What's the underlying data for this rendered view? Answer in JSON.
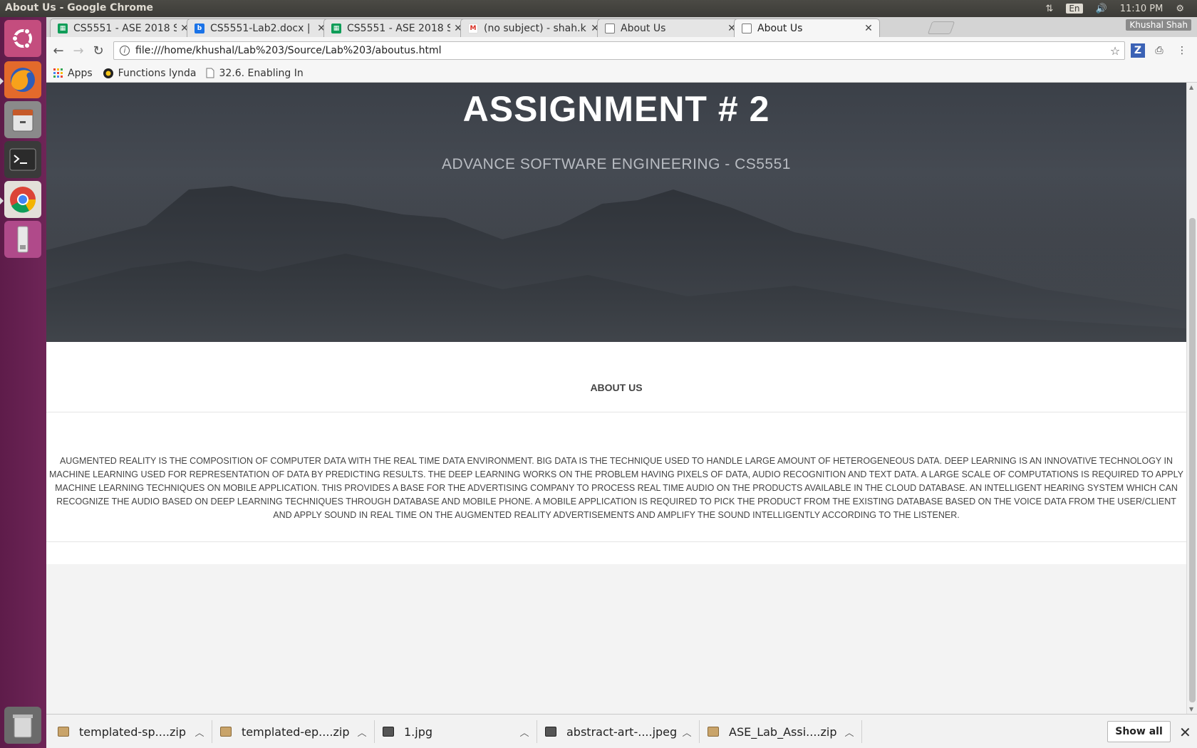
{
  "window": {
    "title": "About Us - Google Chrome",
    "user": "Khushal Shah"
  },
  "tray": {
    "lang": "En",
    "time": "11:10 PM"
  },
  "tabs": [
    {
      "title": "CS5551 - ASE 2018 S",
      "icon": "sheets-icon"
    },
    {
      "title": "CS5551-Lab2.docx |",
      "icon": "box-icon"
    },
    {
      "title": "CS5551 - ASE 2018 S",
      "icon": "sheets-icon"
    },
    {
      "title": "(no subject) - shah.k",
      "icon": "gmail-icon"
    },
    {
      "title": "About Us",
      "icon": "page-icon"
    },
    {
      "title": "About Us",
      "icon": "page-icon"
    }
  ],
  "address": {
    "url": "file:///home/khushal/Lab%203/Source/Lab%203/aboutus.html"
  },
  "bookmarks": [
    {
      "label": "Apps"
    },
    {
      "label": "Functions lynda"
    },
    {
      "label": "32.6. Enabling In"
    }
  ],
  "page": {
    "hero_title": "ASSIGNMENT # 2",
    "hero_subtitle": "ADVANCE SOFTWARE ENGINEERING - CS5551",
    "about_heading": "ABOUT US",
    "about_text": "AUGMENTED REALITY IS THE COMPOSITION OF COMPUTER DATA WITH THE REAL TIME DATA ENVIRONMENT. BIG DATA IS THE TECHNIQUE USED TO HANDLE LARGE AMOUNT OF HETEROGENEOUS DATA. DEEP LEARNING IS AN INNOVATIVE TECHNOLOGY IN MACHINE LEARNING USED FOR REPRESENTATION OF DATA BY PREDICTING RESULTS. THE DEEP LEARNING WORKS ON THE PROBLEM HAVING PIXELS OF DATA, AUDIO RECOGNITION AND TEXT DATA. A LARGE SCALE OF COMPUTATIONS IS REQUIRED TO APPLY MACHINE LEARNING TECHNIQUES ON MOBILE APPLICATION. THIS PROVIDES A BASE FOR THE ADVERTISING COMPANY TO PROCESS REAL TIME AUDIO ON THE PRODUCTS AVAILABLE IN THE CLOUD DATABASE. AN INTELLIGENT HEARING SYSTEM WHICH CAN RECOGNIZE THE AUDIO BASED ON DEEP LEARNING TECHNIQUES THROUGH DATABASE AND MOBILE PHONE. A MOBILE APPLICATION IS REQUIRED TO PICK THE PRODUCT FROM THE EXISTING DATABASE BASED ON THE VOICE DATA FROM THE USER/CLIENT AND APPLY SOUND IN REAL TIME ON THE AUGMENTED REALITY ADVERTISEMENTS AND AMPLIFY THE SOUND INTELLIGENTLY ACCORDING TO THE LISTENER."
  },
  "downloads": [
    {
      "name": "templated-sp....zip",
      "icon": "zip-icon"
    },
    {
      "name": "templated-ep....zip",
      "icon": "zip-icon"
    },
    {
      "name": "1.jpg",
      "icon": "image-icon"
    },
    {
      "name": "abstract-art-....jpeg",
      "icon": "image-icon"
    },
    {
      "name": "ASE_Lab_Assi....zip",
      "icon": "zip-icon"
    }
  ],
  "download_shelf": {
    "show_all": "Show all"
  },
  "colors": {
    "launcher": "#6e2557",
    "hero_bg": "#3d4148",
    "link_accent": "#1a73e8"
  }
}
